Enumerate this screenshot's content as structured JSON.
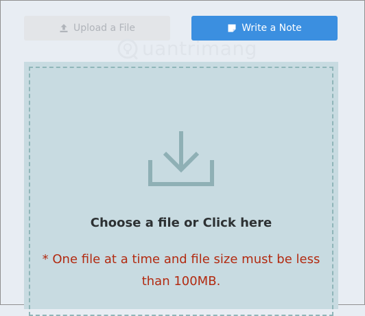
{
  "tabs": {
    "upload": {
      "label": "Upload a File",
      "icon": "upload-icon",
      "state": "inactive"
    },
    "note": {
      "label": "Write a Note",
      "icon": "note-icon",
      "state": "active"
    }
  },
  "watermark": {
    "text": "uantrimang",
    "logo": "quantrimang-logo"
  },
  "dropzone": {
    "icon": "download-icon",
    "title": "Choose a file or Click here",
    "note": "* One file at a time and file size must be less than 100MB."
  },
  "colors": {
    "active_tab": "#3b8fe0",
    "inactive_tab": "#e3e5e8",
    "dropzone_bg": "#c8dbe1",
    "dropzone_border": "#8fb5b8",
    "note_text": "#b22a10"
  }
}
